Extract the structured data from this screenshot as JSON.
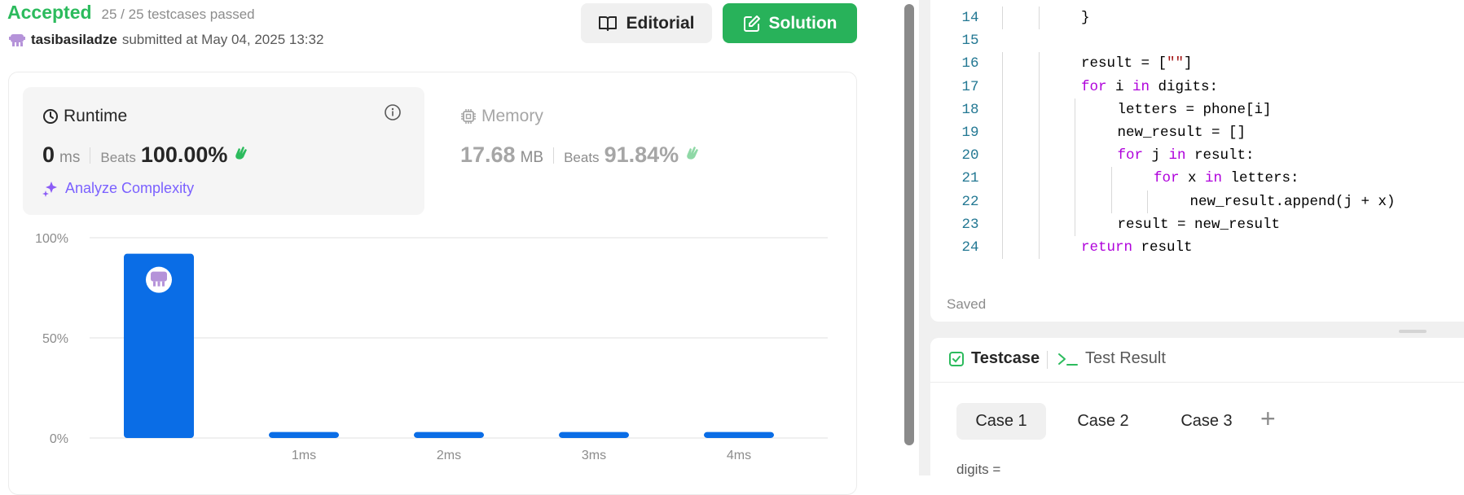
{
  "submission": {
    "status": "Accepted",
    "testcases": "25 / 25 testcases passed",
    "username": "tasibasiladze",
    "submitted_text": "submitted at May 04, 2025 13:32"
  },
  "buttons": {
    "editorial": "Editorial",
    "solution": "Solution"
  },
  "runtime": {
    "title": "Runtime",
    "value": "0",
    "unit": "ms",
    "beats_label": "Beats",
    "beats_value": "100.00%",
    "analyze": "Analyze Complexity"
  },
  "memory": {
    "title": "Memory",
    "value": "17.68",
    "unit": "MB",
    "beats_label": "Beats",
    "beats_value": "91.84%"
  },
  "chart_data": {
    "type": "bar",
    "categories": [
      "0ms",
      "1ms",
      "2ms",
      "3ms",
      "4ms"
    ],
    "x_tick_labels": [
      "",
      "1ms",
      "2ms",
      "3ms",
      "4ms"
    ],
    "values": [
      92,
      3,
      3,
      3,
      3
    ],
    "y_ticks": [
      "100%",
      "50%",
      "0%"
    ],
    "ylim": [
      0,
      100
    ],
    "highlighted_index": 0,
    "bar_color": "#0a6de6",
    "grid": true
  },
  "editor": {
    "lines": [
      {
        "n": "14",
        "indent": 2,
        "tokens": [
          {
            "t": "}",
            "c": ""
          }
        ]
      },
      {
        "n": "15",
        "indent": 0,
        "tokens": []
      },
      {
        "n": "16",
        "indent": 2,
        "tokens": [
          {
            "t": "result = [",
            "c": ""
          },
          {
            "t": "\"\"",
            "c": "str"
          },
          {
            "t": "]",
            "c": ""
          }
        ]
      },
      {
        "n": "17",
        "indent": 2,
        "tokens": [
          {
            "t": "for",
            "c": "kw"
          },
          {
            "t": " i ",
            "c": ""
          },
          {
            "t": "in",
            "c": "kw"
          },
          {
            "t": " digits:",
            "c": ""
          }
        ]
      },
      {
        "n": "18",
        "indent": 3,
        "tokens": [
          {
            "t": "letters = phone[i]",
            "c": ""
          }
        ]
      },
      {
        "n": "19",
        "indent": 3,
        "tokens": [
          {
            "t": "new_result = []",
            "c": ""
          }
        ]
      },
      {
        "n": "20",
        "indent": 3,
        "tokens": [
          {
            "t": "for",
            "c": "kw"
          },
          {
            "t": " j ",
            "c": ""
          },
          {
            "t": "in",
            "c": "kw"
          },
          {
            "t": " result:",
            "c": ""
          }
        ]
      },
      {
        "n": "21",
        "indent": 4,
        "tokens": [
          {
            "t": "for",
            "c": "kw"
          },
          {
            "t": " x ",
            "c": ""
          },
          {
            "t": "in",
            "c": "kw"
          },
          {
            "t": " letters:",
            "c": ""
          }
        ]
      },
      {
        "n": "22",
        "indent": 5,
        "tokens": [
          {
            "t": "new_result.append(j + x)",
            "c": ""
          }
        ]
      },
      {
        "n": "23",
        "indent": 3,
        "tokens": [
          {
            "t": "result = new_result",
            "c": ""
          }
        ]
      },
      {
        "n": "24",
        "indent": 2,
        "tokens": [
          {
            "t": "return",
            "c": "kw"
          },
          {
            "t": " result",
            "c": ""
          }
        ]
      }
    ],
    "saved": "Saved"
  },
  "testpanel": {
    "tab_testcase": "Testcase",
    "tab_result": "Test Result",
    "cases": [
      "Case 1",
      "Case 2",
      "Case 3"
    ],
    "add": "+",
    "input_label": "digits ="
  },
  "colors": {
    "accepted": "#2cbb5d",
    "solution_button": "#28b25a",
    "bar": "#0a6de6",
    "analyze": "#7b61ff"
  }
}
